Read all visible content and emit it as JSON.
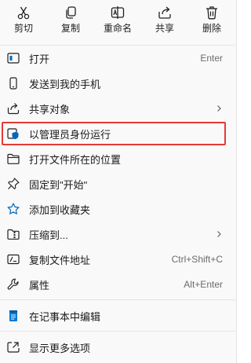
{
  "quick_actions": [
    {
      "label": "剪切",
      "icon": "scissors-icon"
    },
    {
      "label": "复制",
      "icon": "copy-icon"
    },
    {
      "label": "重命名",
      "icon": "rename-icon"
    },
    {
      "label": "共享",
      "icon": "share-icon"
    },
    {
      "label": "删除",
      "icon": "trash-icon"
    }
  ],
  "items": [
    {
      "label": "打开",
      "shortcut": "Enter",
      "icon": "open-window-icon"
    },
    {
      "label": "发送到我的手机",
      "shortcut": "",
      "icon": "phone-icon"
    },
    {
      "label": "共享对象",
      "shortcut": "",
      "icon": "share-icon",
      "submenu": true
    },
    {
      "label": "以管理员身份运行",
      "shortcut": "",
      "icon": "shield-icon",
      "highlighted": true
    },
    {
      "label": "打开文件所在的位置",
      "shortcut": "",
      "icon": "folder-icon"
    },
    {
      "label": "固定到\"开始\"",
      "shortcut": "",
      "icon": "pin-icon"
    },
    {
      "label": "添加到收藏夹",
      "shortcut": "",
      "icon": "star-icon"
    },
    {
      "label": "压缩到...",
      "shortcut": "",
      "icon": "zip-folder-icon",
      "submenu": true
    },
    {
      "label": "复制文件地址",
      "shortcut": "Ctrl+Shift+C",
      "icon": "copy-path-icon"
    },
    {
      "label": "属性",
      "shortcut": "Alt+Enter",
      "icon": "wrench-icon"
    },
    {
      "label": "在记事本中编辑",
      "shortcut": "",
      "icon": "notepad-icon"
    },
    {
      "label": "显示更多选项",
      "shortcut": "",
      "icon": "more-options-icon"
    }
  ],
  "colors": {
    "accent": "#0067c0",
    "highlight_border": "#e53935"
  }
}
